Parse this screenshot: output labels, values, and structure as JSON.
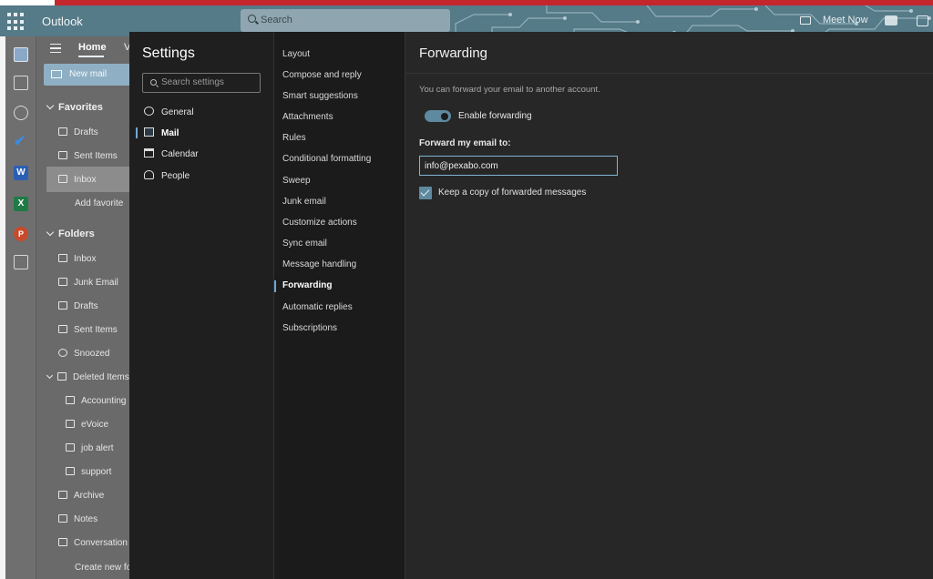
{
  "app": {
    "name": "Outlook",
    "search_placeholder": "Search",
    "meet_now": "Meet Now"
  },
  "rail": {
    "icons": [
      "mail-icon",
      "calendar-icon",
      "people-icon",
      "todo-icon",
      "word-icon",
      "excel-icon",
      "powerpoint-icon",
      "more-apps-icon"
    ]
  },
  "folder_pane": {
    "tab_home": "Home",
    "tab_view": "V",
    "new_mail": "New mail",
    "favorites_header": "Favorites",
    "favorites": [
      {
        "label": "Drafts",
        "icon": "drafts-icon"
      },
      {
        "label": "Sent Items",
        "icon": "sent-icon"
      },
      {
        "label": "Inbox",
        "icon": "inbox-icon",
        "selected": true
      },
      {
        "label": "Add favorite",
        "icon": ""
      }
    ],
    "folders_header": "Folders",
    "folders": [
      {
        "label": "Inbox",
        "icon": "inbox-icon"
      },
      {
        "label": "Junk Email",
        "icon": "junk-icon"
      },
      {
        "label": "Drafts",
        "icon": "drafts-icon"
      },
      {
        "label": "Sent Items",
        "icon": "sent-icon"
      },
      {
        "label": "Snoozed",
        "icon": "clock-icon"
      },
      {
        "label": "Deleted Items",
        "icon": "trash-icon"
      },
      {
        "label": "Accounting",
        "icon": "folder-icon"
      },
      {
        "label": "eVoice",
        "icon": "folder-icon"
      },
      {
        "label": "job alert",
        "icon": "folder-icon"
      },
      {
        "label": "support",
        "icon": "folder-icon"
      },
      {
        "label": "Archive",
        "icon": "archive-icon"
      },
      {
        "label": "Notes",
        "icon": "notes-icon"
      },
      {
        "label": "Conversation",
        "icon": "folder-icon"
      },
      {
        "label": "Create new fo",
        "icon": ""
      }
    ]
  },
  "settings": {
    "title": "Settings",
    "search_placeholder": "Search settings",
    "categories": [
      {
        "label": "General",
        "icon": "gear-icon"
      },
      {
        "label": "Mail",
        "icon": "mail-icon",
        "selected": true
      },
      {
        "label": "Calendar",
        "icon": "calendar-icon"
      },
      {
        "label": "People",
        "icon": "people-icon"
      }
    ],
    "mail_items": [
      "Layout",
      "Compose and reply",
      "Smart suggestions",
      "Attachments",
      "Rules",
      "Conditional formatting",
      "Sweep",
      "Junk email",
      "Customize actions",
      "Sync email",
      "Message handling",
      "Forwarding",
      "Automatic replies",
      "Subscriptions"
    ],
    "selected_item": "Forwarding"
  },
  "forwarding": {
    "title": "Forwarding",
    "description": "You can forward your email to another account.",
    "enable_label": "Enable forwarding",
    "enabled": true,
    "forward_to_label": "Forward my email to:",
    "forward_to_value": "info@pexabo.com",
    "keep_copy_label": "Keep a copy of forwarded messages",
    "keep_copy": true
  },
  "colors": {
    "accent": "#5e8aa0",
    "topbar": "#557a88",
    "input_focus": "#7eb6d6"
  }
}
